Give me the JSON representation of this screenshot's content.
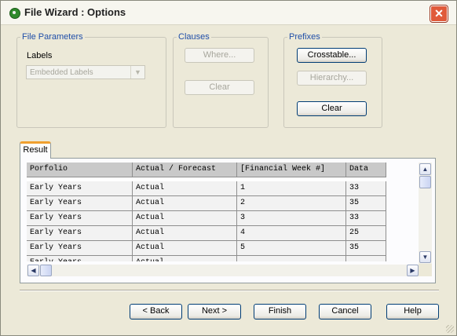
{
  "window": {
    "title": "File Wizard : Options",
    "close_glyph": "✕"
  },
  "file_parameters": {
    "legend": "File Parameters",
    "labels_caption": "Labels",
    "labels_value": "Embedded Labels"
  },
  "clauses": {
    "legend": "Clauses",
    "where_label": "Where...",
    "clear_label": "Clear"
  },
  "prefixes": {
    "legend": "Prefixes",
    "crosstable_label": "Crosstable...",
    "hierarchy_label": "Hierarchy...",
    "clear_label": "Clear"
  },
  "result": {
    "tab_label": "Result",
    "columns": [
      "Porfolio",
      "Actual / Forecast",
      "[Financial Week #]",
      "Data"
    ],
    "rows": [
      [
        "Early Years",
        "Actual",
        "1",
        "33"
      ],
      [
        "Early Years",
        "Actual",
        "2",
        "35"
      ],
      [
        "Early Years",
        "Actual",
        "3",
        "33"
      ],
      [
        "Early Years",
        "Actual",
        "4",
        "25"
      ],
      [
        "Early Years",
        "Actual",
        "5",
        "35"
      ]
    ]
  },
  "footer": {
    "back_label": "< Back",
    "next_label": "Next >",
    "finish_label": "Finish",
    "cancel_label": "Cancel",
    "help_label": "Help"
  }
}
